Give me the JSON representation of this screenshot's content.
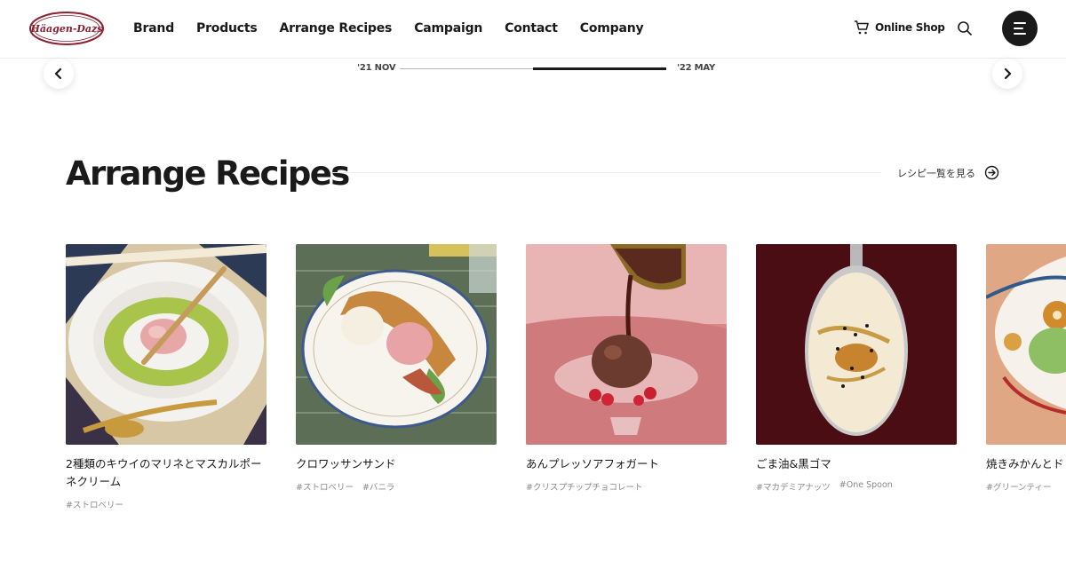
{
  "brand": {
    "logo_text": "Häagen-Dazs"
  },
  "nav": {
    "items": [
      {
        "label": "Brand"
      },
      {
        "label": "Products"
      },
      {
        "label": "Arrange Recipes"
      },
      {
        "label": "Campaign"
      },
      {
        "label": "Contact"
      },
      {
        "label": "Company"
      }
    ],
    "shop_label": "Online Shop"
  },
  "carousel": {
    "start_label": "'21 NOV",
    "end_label": "'22 MAY",
    "progress_start": 0.5,
    "progress_end": 1.0
  },
  "section": {
    "title": "Arrange Recipes",
    "view_all": "レシピ一覧を見る"
  },
  "cards": [
    {
      "title": "2種類のキウイのマリネとマスカルポーネクリーム",
      "tags": [
        "#ストロベリー"
      ],
      "image": "kiwi-marinade-plate"
    },
    {
      "title": "クロワッサンサンド",
      "tags": [
        "#ストロベリー",
        "#バニラ"
      ],
      "image": "croissant-sandwich-plate"
    },
    {
      "title": "あんプレッソアフォガート",
      "tags": [
        "#クリスプチップチョコレート"
      ],
      "image": "affogato-glass"
    },
    {
      "title": "ごま油&黒ゴマ",
      "tags": [
        "#マカデミアナッツ",
        "#One Spoon"
      ],
      "image": "spoon-sesame"
    },
    {
      "title": "焼きみかんとド",
      "tags": [
        "#グリーンティー"
      ],
      "image": "mikan-plate"
    }
  ],
  "colors": {
    "brand": "#8b1e2f",
    "text": "#1a1a1a",
    "muted": "#8a8a8a"
  }
}
